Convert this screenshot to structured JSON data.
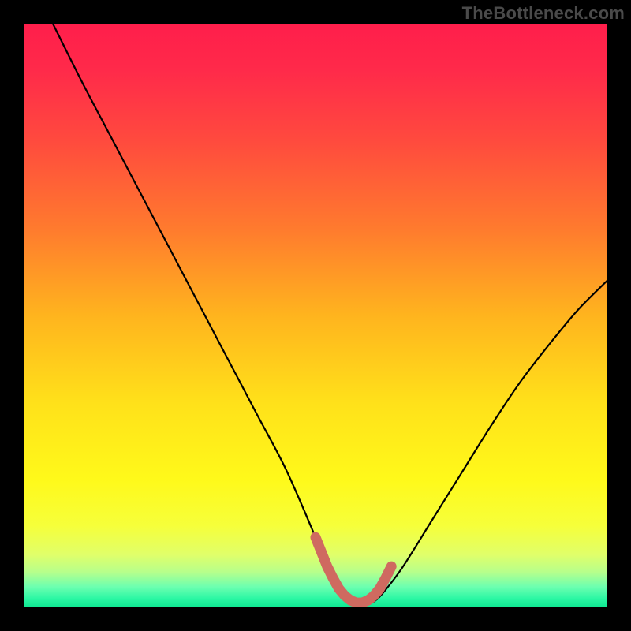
{
  "watermark": "TheBottleneck.com",
  "colors": {
    "frame": "#000000",
    "curve": "#000000",
    "marker": "#cf6a60",
    "gradient_stops": [
      {
        "offset": 0.0,
        "color": "#ff1e4b"
      },
      {
        "offset": 0.08,
        "color": "#ff2a4a"
      },
      {
        "offset": 0.2,
        "color": "#ff4a3e"
      },
      {
        "offset": 0.35,
        "color": "#ff7a2e"
      },
      {
        "offset": 0.5,
        "color": "#ffb41e"
      },
      {
        "offset": 0.65,
        "color": "#ffe11a"
      },
      {
        "offset": 0.78,
        "color": "#fff91a"
      },
      {
        "offset": 0.86,
        "color": "#f6ff3a"
      },
      {
        "offset": 0.91,
        "color": "#e0ff6a"
      },
      {
        "offset": 0.94,
        "color": "#b6ff8c"
      },
      {
        "offset": 0.965,
        "color": "#6cffb0"
      },
      {
        "offset": 0.985,
        "color": "#2bf7a4"
      },
      {
        "offset": 1.0,
        "color": "#0ee892"
      }
    ]
  },
  "chart_data": {
    "type": "line",
    "title": "",
    "xlabel": "",
    "ylabel": "",
    "xlim": [
      0,
      100
    ],
    "ylim": [
      0,
      100
    ],
    "legend": false,
    "grid": false,
    "minimum_x": 57,
    "series": [
      {
        "name": "bottleneck-curve",
        "x": [
          5,
          10,
          15,
          20,
          25,
          30,
          35,
          40,
          45,
          50,
          52,
          54,
          56,
          58,
          60,
          62,
          65,
          70,
          75,
          80,
          85,
          90,
          95,
          100
        ],
        "y": [
          100,
          90,
          80.5,
          71,
          61.5,
          52,
          42.5,
          33,
          23.5,
          12,
          7,
          3,
          1,
          0.5,
          1,
          3,
          7,
          15,
          23,
          31,
          38.5,
          45,
          51,
          56
        ]
      },
      {
        "name": "optimal-marker",
        "x": [
          50,
          51,
          52,
          53,
          54,
          55,
          56,
          57,
          58,
          59,
          60,
          61,
          62,
          63
        ],
        "y": [
          12,
          9.5,
          7,
          5,
          3.2,
          2,
          1.2,
          0.8,
          0.8,
          1.2,
          2,
          3.2,
          5,
          7
        ]
      }
    ]
  }
}
